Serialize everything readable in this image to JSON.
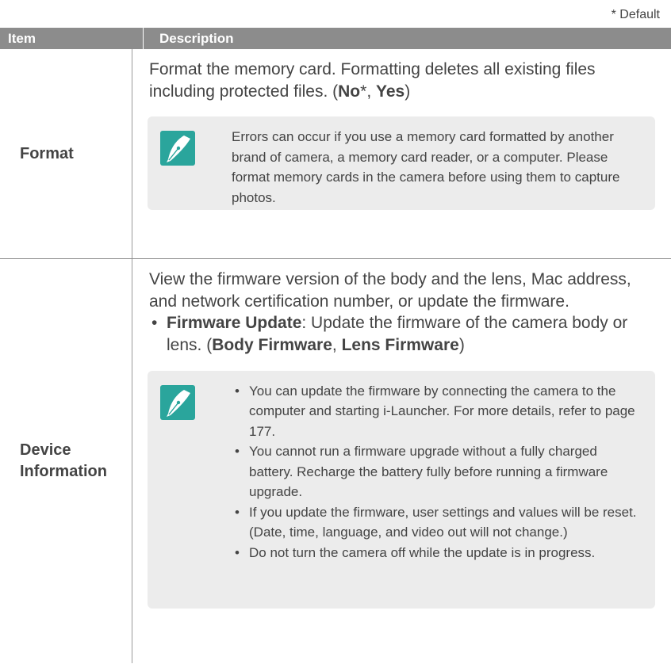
{
  "default_note": "* Default",
  "header": {
    "item": "Item",
    "description": "Description"
  },
  "rows": [
    {
      "item": "Format",
      "desc_intro": "Format the memory card. Formatting deletes all existing files including protected files. (",
      "opt_no": "No",
      "opt_star": "*, ",
      "opt_yes": "Yes",
      "desc_close": ")",
      "note": "Errors can occur if you use a memory card formatted by another brand of camera, a memory card reader, or a computer. Please format memory cards in the camera before using them to capture photos."
    },
    {
      "item_line1": "Device",
      "item_line2": "Information",
      "desc": "View the firmware version of the body and the lens, Mac address, and network certification number, or update the firmware.",
      "fw_label": "Firmware Update",
      "fw_text": ": Update the firmware of the camera body or lens. (",
      "fw_body": "Body Firmware",
      "fw_sep": ", ",
      "fw_lens": "Lens Firmware",
      "fw_close": ")",
      "notes": [
        "You can update the firmware by connecting the camera to the computer and starting i-Launcher. For more details, refer to page 177.",
        "You cannot run a firmware upgrade without a fully charged battery. Recharge the battery fully before running a firmware upgrade.",
        "If you update the firmware, user settings and values will be reset. (Date, time, language, and video out will not change.)",
        "Do not turn the camera off while the update is in progress."
      ]
    }
  ],
  "colors": {
    "header_bg": "#8c8c8c",
    "note_bg": "#ececec",
    "icon_teal": "#2aa59c"
  },
  "icons": {
    "note": "pen-nib-note-icon"
  }
}
